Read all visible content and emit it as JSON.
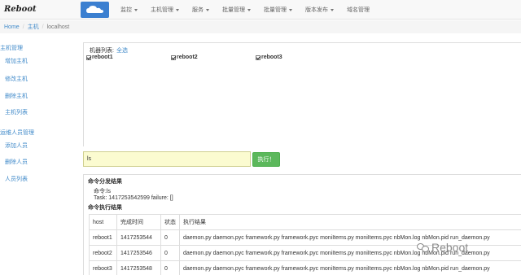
{
  "brand": {
    "logo_text": "Reboot"
  },
  "nav": {
    "items": [
      {
        "label": "监控",
        "caret": true
      },
      {
        "label": "主机管理",
        "caret": true
      },
      {
        "label": "服务",
        "caret": true
      },
      {
        "label": "批量管理",
        "caret": true
      },
      {
        "label": "批量管理",
        "caret": true
      },
      {
        "label": "版本发布",
        "caret": true
      },
      {
        "label": "域名管理",
        "caret": false
      }
    ]
  },
  "breadcrumb": {
    "home": "Home",
    "section": "主机",
    "current": "localhost"
  },
  "sidebar": {
    "group1": "主机管理",
    "group1_items": [
      "增加主机",
      "修改主机",
      "删除主机",
      "主机列表"
    ],
    "group2": "运维人员管理",
    "group2_items": [
      "添加人员",
      "删除人员",
      "人员列表"
    ]
  },
  "hosts": {
    "title": "机器列表:",
    "select_all": "全选",
    "list": [
      {
        "name": "reboot1",
        "checked": true
      },
      {
        "name": "reboot2",
        "checked": true
      },
      {
        "name": "reboot3",
        "checked": true
      }
    ]
  },
  "command": {
    "value": "ls",
    "execute_label": "执行！"
  },
  "results": {
    "dispatch_title": "命令分发结果",
    "command_line": "命令:ls",
    "task_line": "Task: 1417253542599 failure: []",
    "exec_title": "命令执行结果",
    "headers": [
      "host",
      "完成时间",
      "状态",
      "执行结果"
    ],
    "rows": [
      [
        "reboot1",
        "1417253544",
        "0",
        "daemon.py daemon.pyc framework.py framework.pyc moniItems.py moniItems.pyc nbMon.log nbMon.pid run_daemon.py"
      ],
      [
        "reboot2",
        "1417253546",
        "0",
        "daemon.py daemon.pyc framework.py framework.pyc moniItems.py moniItems.pyc nbMon.log nbMon.pid run_daemon.py"
      ],
      [
        "reboot3",
        "1417253548",
        "0",
        "daemon.py daemon.pyc framework.py framework.pyc moniItems.py moniItems.pyc nbMon.log nbMon.pid run_daemon.py"
      ]
    ]
  },
  "watermark": {
    "text": "Reboot"
  },
  "colors": {
    "accent": "#428bca",
    "success": "#5cb85c",
    "input_bg": "#fbfbd0",
    "brand_blue": "#3b7fd0"
  }
}
